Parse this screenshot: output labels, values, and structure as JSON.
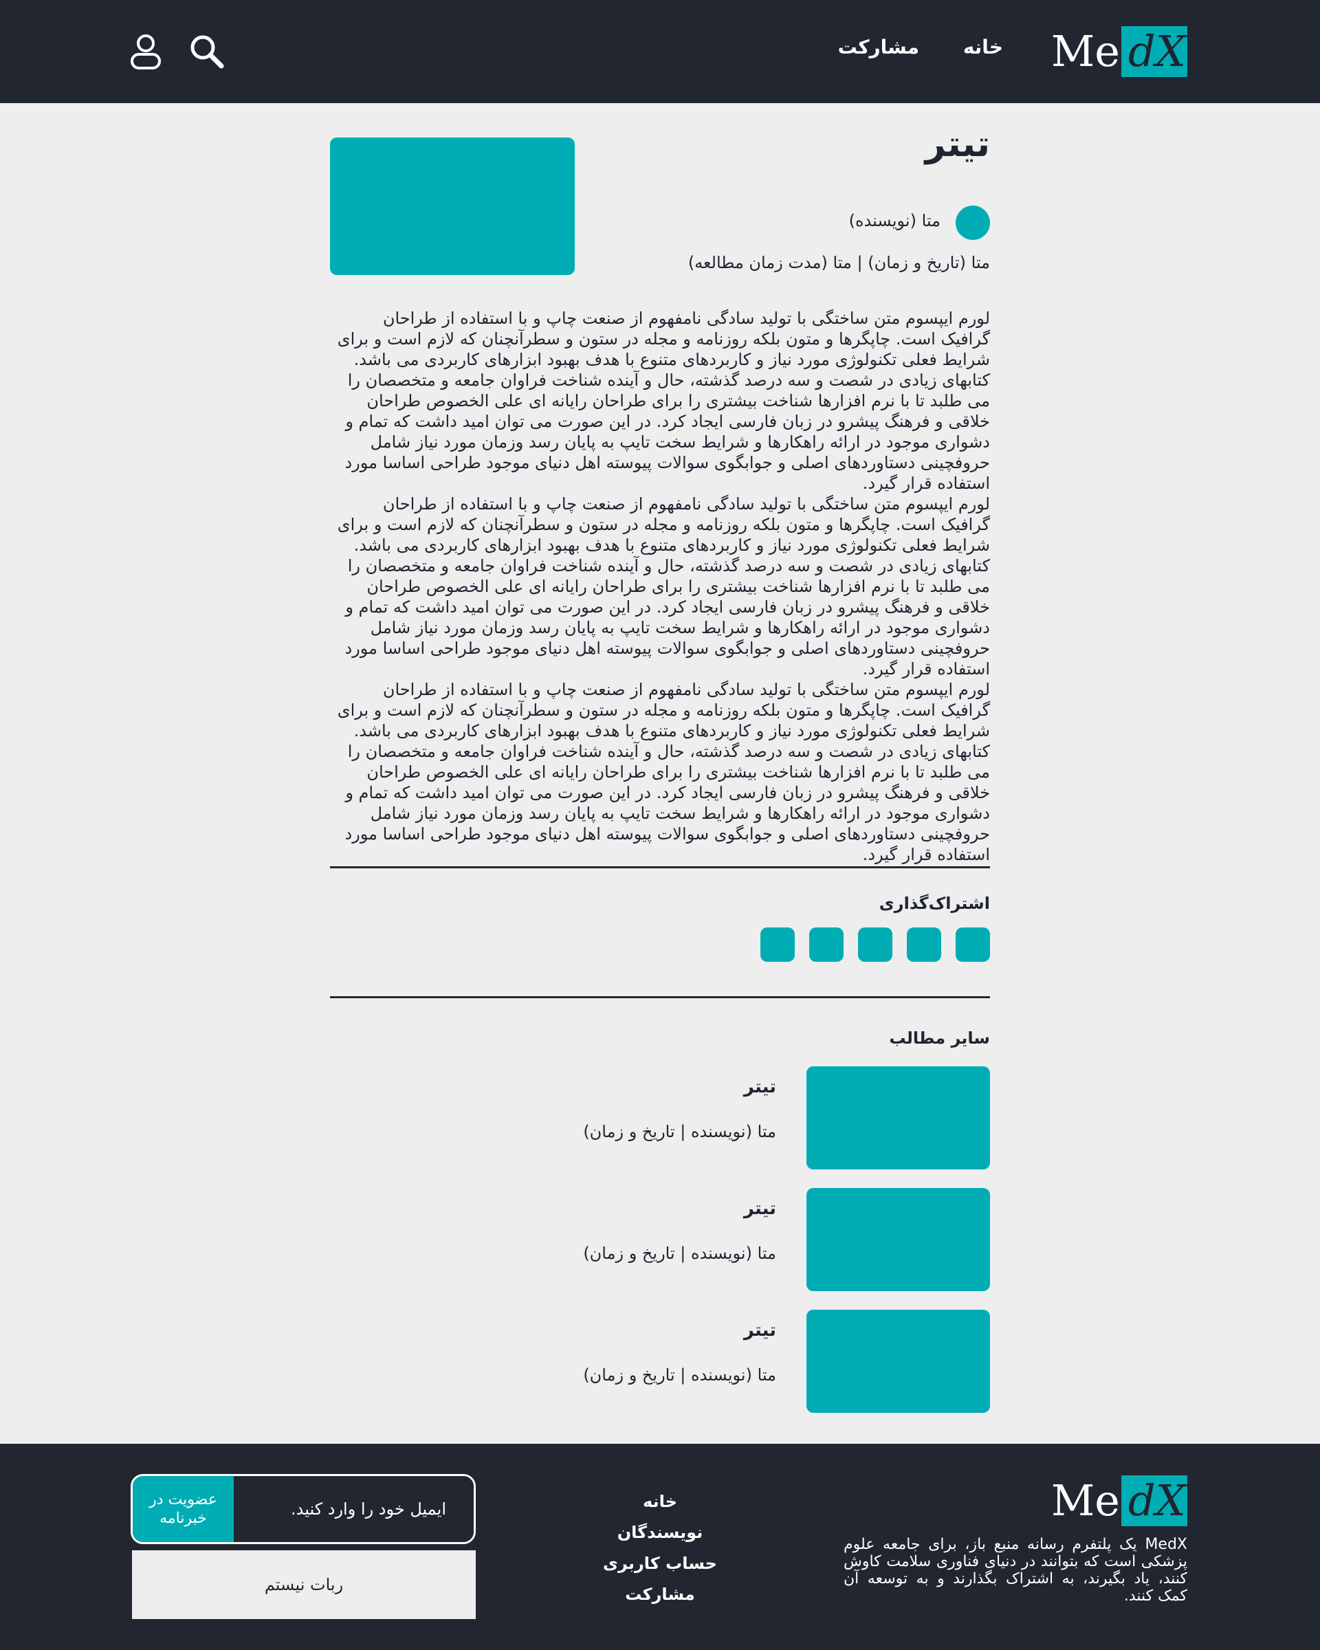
{
  "brand": {
    "logo_prefix": "Me",
    "logo_suffix": "dX",
    "accent_color": "#00adb5",
    "dark_color": "#212631"
  },
  "header": {
    "nav": {
      "home": "خانه",
      "contribute": "مشارکت"
    },
    "icons": {
      "search": "search-icon",
      "user": "user-icon"
    }
  },
  "article": {
    "title": "تیتر",
    "author_meta": "متا (نویسنده)",
    "date_meta": "متا (تاریخ و زمان) | متا (مدت زمان مطالعه)",
    "paragraphs": [
      "لورم ایپسوم متن ساختگی با تولید سادگی نامفهوم از صنعت چاپ و با استفاده از طراحان گرافیک است. چاپگرها و متون بلکه روزنامه و مجله در ستون و سطرآنچنان که لازم است و برای شرایط فعلی تکنولوژی مورد نیاز و کاربردهای متنوع با هدف بهبود ابزارهای کاربردی می باشد. کتابهای زیادی در شصت و سه درصد گذشته، حال و آینده شناخت فراوان جامعه و متخصصان را می طلبد تا با نرم افزارها شناخت بیشتری را برای طراحان رایانه ای علی الخصوص طراحان خلاقی و فرهنگ پیشرو در زبان فارسی ایجاد کرد. در این صورت می توان امید داشت که تمام و دشواری موجود در ارائه راهکارها و شرایط سخت تایپ به پایان رسد وزمان مورد نیاز شامل حروفچینی دستاوردهای اصلی و جوابگوی سوالات پیوسته اهل دنیای موجود طراحی اساسا مورد استفاده قرار گیرد.",
      "لورم ایپسوم متن ساختگی با تولید سادگی نامفهوم از صنعت چاپ و با استفاده از طراحان گرافیک است. چاپگرها و متون بلکه روزنامه و مجله در ستون و سطرآنچنان که لازم است و برای شرایط فعلی تکنولوژی مورد نیاز و کاربردهای متنوع با هدف بهبود ابزارهای کاربردی می باشد. کتابهای زیادی در شصت و سه درصد گذشته، حال و آینده شناخت فراوان جامعه و متخصصان را می طلبد تا با نرم افزارها شناخت بیشتری را برای طراحان رایانه ای علی الخصوص طراحان خلاقی و فرهنگ پیشرو در زبان فارسی ایجاد کرد. در این صورت می توان امید داشت که تمام و دشواری موجود در ارائه راهکارها و شرایط سخت تایپ به پایان رسد وزمان مورد نیاز شامل حروفچینی دستاوردهای اصلی و جوابگوی سوالات پیوسته اهل دنیای موجود طراحی اساسا مورد استفاده قرار گیرد.",
      "لورم ایپسوم متن ساختگی با تولید سادگی نامفهوم از صنعت چاپ و با استفاده از طراحان گرافیک است. چاپگرها و متون بلکه روزنامه و مجله در ستون و سطرآنچنان که لازم است و برای شرایط فعلی تکنولوژی مورد نیاز و کاربردهای متنوع با هدف بهبود ابزارهای کاربردی می باشد. کتابهای زیادی در شصت و سه درصد گذشته، حال و آینده شناخت فراوان جامعه و متخصصان را می طلبد تا با نرم افزارها شناخت بیشتری را برای طراحان رایانه ای علی الخصوص طراحان خلاقی و فرهنگ پیشرو در زبان فارسی ایجاد کرد. در این صورت می توان امید داشت که تمام و دشواری موجود در ارائه راهکارها و شرایط سخت تایپ به پایان رسد وزمان مورد نیاز شامل حروفچینی دستاوردهای اصلی و جوابگوی سوالات پیوسته اهل دنیای موجود طراحی اساسا مورد استفاده قرار گیرد."
    ]
  },
  "share": {
    "label": "اشتراک‌گذاری",
    "button_count": 5
  },
  "related": {
    "label": "سایر مطالب",
    "items": [
      {
        "title": "تیتر",
        "meta": "متا (نویسنده | تاریخ و زمان)"
      },
      {
        "title": "تیتر",
        "meta": "متا (نویسنده | تاریخ و زمان)"
      },
      {
        "title": "تیتر",
        "meta": "متا (نویسنده | تاریخ و زمان)"
      }
    ]
  },
  "footer": {
    "description": "MedX یک پلتفرم رسانه منبع باز، برای جامعه علوم پزشکی است که بتوانند در دنیای فناوری سلامت کاوش کنند، یاد بگیرند، به اشتراک بگذارند و به توسعه آن کمک کنند.",
    "links": [
      "خانه",
      "نویسندگان",
      "حساب کاربری",
      "مشارکت"
    ],
    "newsletter": {
      "placeholder": "ایمیل خود را وارد کنید.",
      "button_label": "عضویت در خبرنامه"
    },
    "captcha_label": "ربات نیستم"
  }
}
